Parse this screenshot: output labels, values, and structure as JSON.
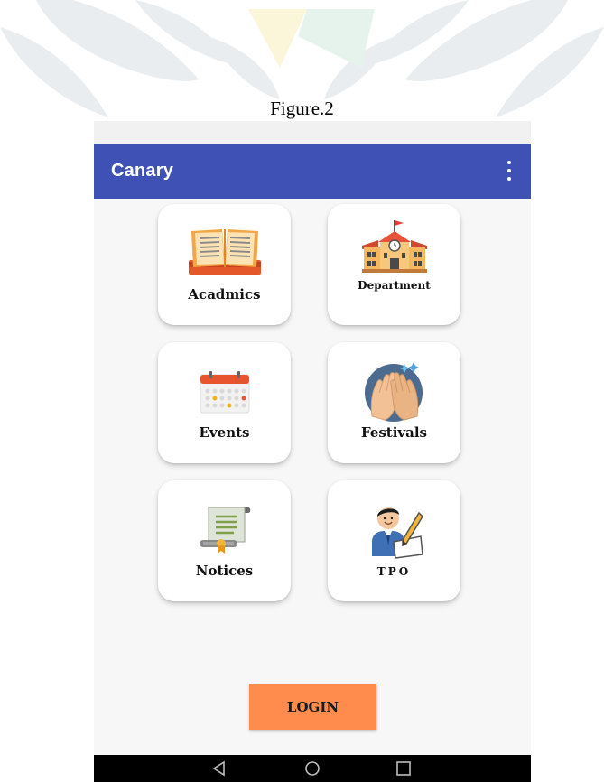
{
  "caption": "Figure.2",
  "app": {
    "title": "Canary",
    "menu_icon": "more-vert-icon",
    "accent_color": "#3f51b5"
  },
  "grid": [
    {
      "label": "Acadmics",
      "icon": "open-book-icon"
    },
    {
      "label": "Department",
      "icon": "school-building-icon"
    },
    {
      "label": "Events",
      "icon": "calendar-icon"
    },
    {
      "label": "Festivals",
      "icon": "clapping-hands-icon"
    },
    {
      "label": "Notices",
      "icon": "scroll-certificate-icon"
    },
    {
      "label": "TPO",
      "icon": "student-writing-icon"
    }
  ],
  "login": {
    "label": "LOGIN",
    "color": "#ff8c4c"
  },
  "nav": {
    "back": "back-triangle-icon",
    "home": "home-circle-icon",
    "recents": "recents-square-icon"
  }
}
